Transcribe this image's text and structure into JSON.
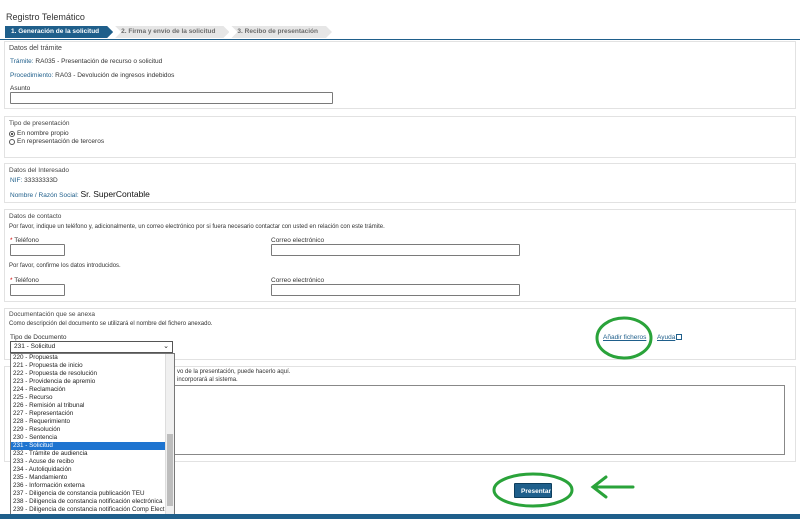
{
  "header": {
    "title": "Registro Telemático"
  },
  "steps": [
    {
      "label": "1. Generación de la solicitud",
      "active": true
    },
    {
      "label": "2. Firma y envío de la solicitud",
      "active": false
    },
    {
      "label": "3. Recibo de presentación",
      "active": false
    }
  ],
  "tramite": {
    "section_title": "Datos del trámite",
    "tramite_label": "Trámite:",
    "tramite_value": "RA035 - Presentación de recurso o solicitud",
    "procedimiento_label": "Procedimiento:",
    "procedimiento_value": "RA03 - Devolución de ingresos indebidos",
    "asunto_label": "Asunto",
    "asunto_value": ""
  },
  "presentacion": {
    "section_title": "Tipo de presentación",
    "option1": "En nombre propio",
    "option2": "En representación de terceros"
  },
  "interesado": {
    "section_title": "Datos del Interesado",
    "nif_label": "NIF:",
    "nif_value": "33333333D",
    "nombre_label": "Nombre / Razón Social:",
    "nombre_value": "Sr. SuperContable"
  },
  "contacto": {
    "section_title": "Datos de contacto",
    "intro": "Por favor, indique un teléfono y, adicionalmente, un correo electrónico por si fuera necesario contactar con usted en relación con este trámite.",
    "confirm_text": "Por favor, confirme los datos introducidos.",
    "required_mark": "*",
    "telefono_label": "Teléfono",
    "correo_label": "Correo electrónico"
  },
  "documentacion": {
    "section_title": "Documentación que se anexa",
    "description": "Como descripción del documento se utilizará el nombre del fichero anexado.",
    "tipo_label": "Tipo de Documento",
    "selected": "231 - Solicitud",
    "add_files_link": "Añadir ficheros",
    "help_link": "Ayuda",
    "options": [
      "220 - Propuesta",
      "221 - Propuesta de inicio",
      "222 - Propuesta de resolución",
      "223 - Providencia de apremio",
      "224 - Reclamación",
      "225 - Recurso",
      "226 - Remisión al tribunal",
      "227 - Representación",
      "228 - Requerimiento",
      "229 - Resolución",
      "230 - Sentencia",
      "231 - Solicitud",
      "232 - Trámite de audiencia",
      "233 - Acuse de recibo",
      "234 - Autoliquidación",
      "235 - Mandamiento",
      "236 - Información externa",
      "237 - Diligencia de constancia publicación TEU",
      "238 - Diligencia de constancia notificación electrónica",
      "239 - Diligencia de constancia notificación Comp Elect"
    ],
    "selected_index": 11
  },
  "observaciones": {
    "line1_fragment": "vo de la presentación, puede hacerlo aquí.",
    "line2_fragment": "incorporará al sistema."
  },
  "actions": {
    "submit_label": "Presentar"
  },
  "colors": {
    "brand": "#1f5f8b",
    "annotation": "#2aa33a",
    "selection": "#1e74d0"
  }
}
